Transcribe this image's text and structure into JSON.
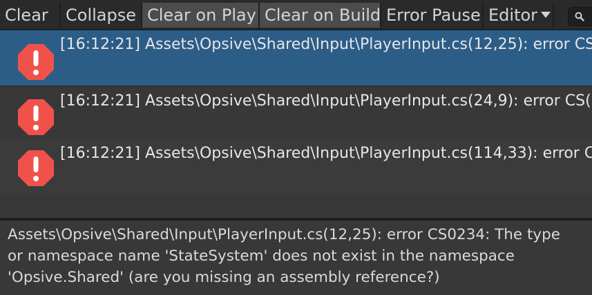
{
  "toolbar": {
    "clear": "Clear",
    "collapse": "Collapse",
    "clear_on_play": "Clear on Play",
    "clear_on_build": "Clear on Build",
    "error_pause": "Error Pause",
    "editor": "Editor"
  },
  "log_entries": [
    {
      "text": "[16:12:21] Assets\\Opsive\\Shared\\Input\\PlayerInput.cs(12,25): error CS",
      "severity": "error",
      "selected": true
    },
    {
      "text": "[16:12:21] Assets\\Opsive\\Shared\\Input\\PlayerInput.cs(24,9): error CS(",
      "severity": "error",
      "selected": false
    },
    {
      "text": "[16:12:21] Assets\\Opsive\\Shared\\Input\\PlayerInput.cs(114,33): error C",
      "severity": "error",
      "selected": false
    }
  ],
  "detail": {
    "lines": [
      "Assets\\Opsive\\Shared\\Input\\PlayerInput.cs(12,25): error CS0234: The type",
      "or namespace name 'StateSystem' does not exist in the namespace",
      "'Opsive.Shared' (are you missing an assembly reference?)"
    ]
  },
  "colors": {
    "selected_row": "#2c5d87",
    "error_icon": "#f0524b",
    "background": "#383838",
    "toolbar": "#2a2a2a"
  },
  "icons": {
    "error": "error-octagon-icon",
    "search": "search-icon",
    "dropdown": "caret-down-icon"
  }
}
